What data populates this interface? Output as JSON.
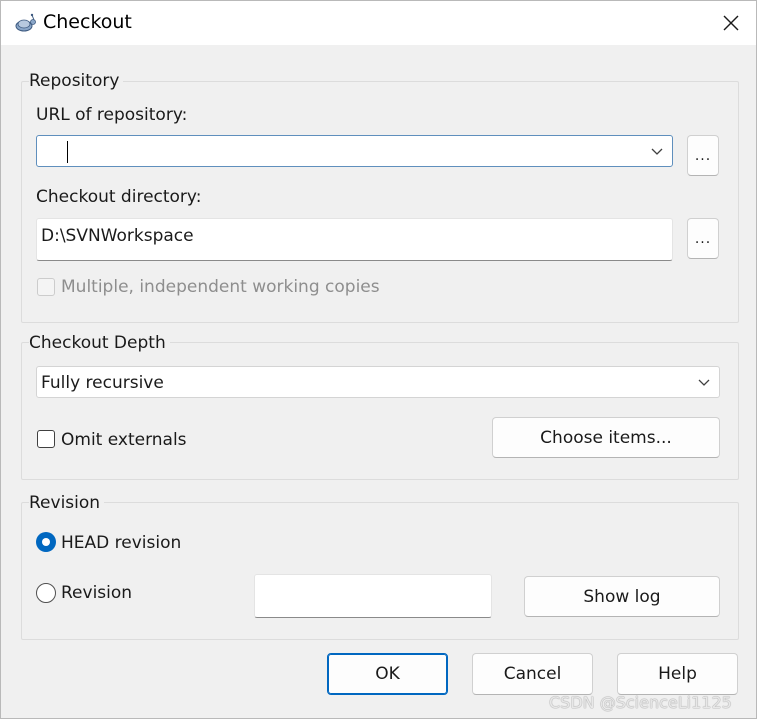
{
  "window": {
    "title": "Checkout",
    "app_icon": "tortoise-icon",
    "close_icon": "close-icon"
  },
  "repository_group": {
    "legend": "Repository",
    "url_label": "URL of repository:",
    "url_value": "",
    "url_browse_label": "...",
    "dir_label": "Checkout directory:",
    "dir_value": "D:\\SVNWorkspace",
    "dir_browse_label": "...",
    "multiple_copies_label": "Multiple, independent working copies",
    "multiple_copies_checked": false,
    "multiple_copies_enabled": false
  },
  "depth_group": {
    "legend": "Checkout Depth",
    "depth_value": "Fully recursive",
    "omit_externals_label": "Omit externals",
    "omit_externals_checked": false,
    "choose_items_label": "Choose items..."
  },
  "revision_group": {
    "legend": "Revision",
    "head_label": "HEAD revision",
    "head_selected": true,
    "revision_label": "Revision",
    "revision_selected": false,
    "revision_value": "",
    "show_log_label": "Show log"
  },
  "buttons": {
    "ok": "OK",
    "cancel": "Cancel",
    "help": "Help"
  },
  "watermark": "CSDN @ScienceLi1125",
  "colors": {
    "accent": "#0067c0",
    "focus_border": "#5f8fbd",
    "background": "#f0f0f0"
  }
}
